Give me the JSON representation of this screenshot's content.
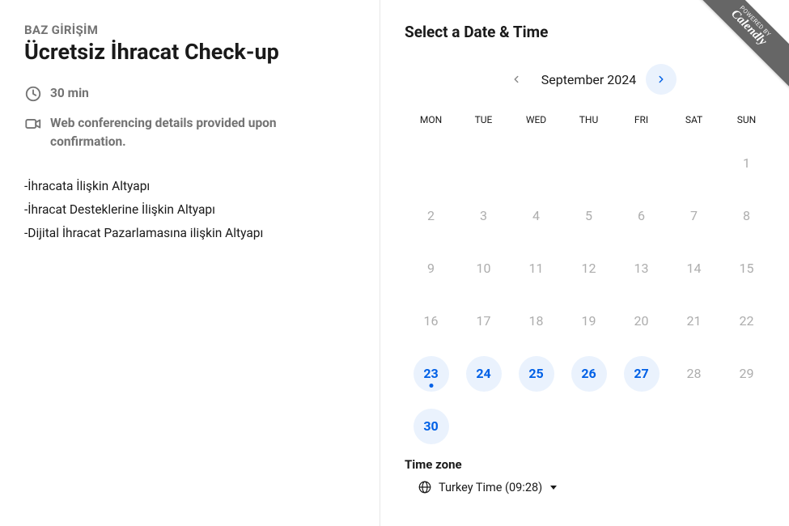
{
  "ribbon": {
    "line1": "POWERED BY",
    "line2": "Calendly"
  },
  "left": {
    "organizer": "BAZ GİRİŞİM",
    "title": "Ücretsiz İhracat Check-up",
    "duration": "30 min",
    "conferencing": "Web conferencing details provided upon confirmation.",
    "description_lines": [
      "-İhracata İlişkin Altyapı",
      "-İhracat Desteklerine İlişkin Altyapı",
      "-Dijital İhracat Pazarlamasına ilişkin Altyapı"
    ]
  },
  "right": {
    "heading": "Select a Date & Time",
    "month_label": "September 2024",
    "weekdays": [
      "MON",
      "TUE",
      "WED",
      "THU",
      "FRI",
      "SAT",
      "SUN"
    ],
    "weeks": [
      [
        {
          "n": "",
          "a": false
        },
        {
          "n": "",
          "a": false
        },
        {
          "n": "",
          "a": false
        },
        {
          "n": "",
          "a": false
        },
        {
          "n": "",
          "a": false
        },
        {
          "n": "",
          "a": false
        },
        {
          "n": "1",
          "a": false
        }
      ],
      [
        {
          "n": "2",
          "a": false
        },
        {
          "n": "3",
          "a": false
        },
        {
          "n": "4",
          "a": false
        },
        {
          "n": "5",
          "a": false
        },
        {
          "n": "6",
          "a": false
        },
        {
          "n": "7",
          "a": false
        },
        {
          "n": "8",
          "a": false
        }
      ],
      [
        {
          "n": "9",
          "a": false
        },
        {
          "n": "10",
          "a": false
        },
        {
          "n": "11",
          "a": false
        },
        {
          "n": "12",
          "a": false
        },
        {
          "n": "13",
          "a": false
        },
        {
          "n": "14",
          "a": false
        },
        {
          "n": "15",
          "a": false
        }
      ],
      [
        {
          "n": "16",
          "a": false
        },
        {
          "n": "17",
          "a": false
        },
        {
          "n": "18",
          "a": false
        },
        {
          "n": "19",
          "a": false
        },
        {
          "n": "20",
          "a": false
        },
        {
          "n": "21",
          "a": false
        },
        {
          "n": "22",
          "a": false
        }
      ],
      [
        {
          "n": "23",
          "a": true,
          "today": true
        },
        {
          "n": "24",
          "a": true
        },
        {
          "n": "25",
          "a": true
        },
        {
          "n": "26",
          "a": true
        },
        {
          "n": "27",
          "a": true
        },
        {
          "n": "28",
          "a": false
        },
        {
          "n": "29",
          "a": false
        }
      ],
      [
        {
          "n": "30",
          "a": true
        },
        {
          "n": "",
          "a": false
        },
        {
          "n": "",
          "a": false
        },
        {
          "n": "",
          "a": false
        },
        {
          "n": "",
          "a": false
        },
        {
          "n": "",
          "a": false
        },
        {
          "n": "",
          "a": false
        }
      ]
    ],
    "timezone_label": "Time zone",
    "timezone_value": "Turkey Time (09:28)"
  }
}
